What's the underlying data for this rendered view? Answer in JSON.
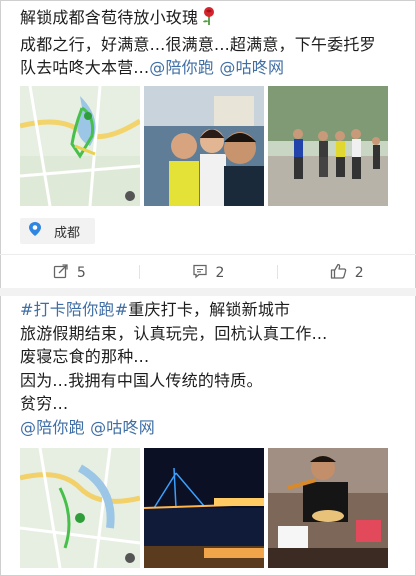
{
  "post1": {
    "line1": "解锁成都含苞待放小玫瑰",
    "line2": "成都之行，好满意...很满意...超满意，下午委托罗",
    "line3_prefix": "队去咕咚大本营...",
    "mention1": "@陪你跑",
    "mention2": "@咕咚网",
    "location": "成都",
    "repost_count": "5",
    "comment_count": "2",
    "like_count": "2"
  },
  "post2": {
    "hashtag": "#打卡陪你跑#",
    "line1_rest": "重庆打卡，解锁新城市",
    "line2": "旅游假期结束，认真玩完，回杭认真工作...",
    "line3": "废寝忘食的那种...",
    "line4": "因为...我拥有中国人传统的特质。",
    "line5": "贫穷...",
    "mention1": "@陪你跑",
    "mention2": "@咕咚网"
  },
  "colors": {
    "link": "#3f6ea5",
    "separator": "#f2f2f2",
    "text": "#1d1d1d"
  }
}
